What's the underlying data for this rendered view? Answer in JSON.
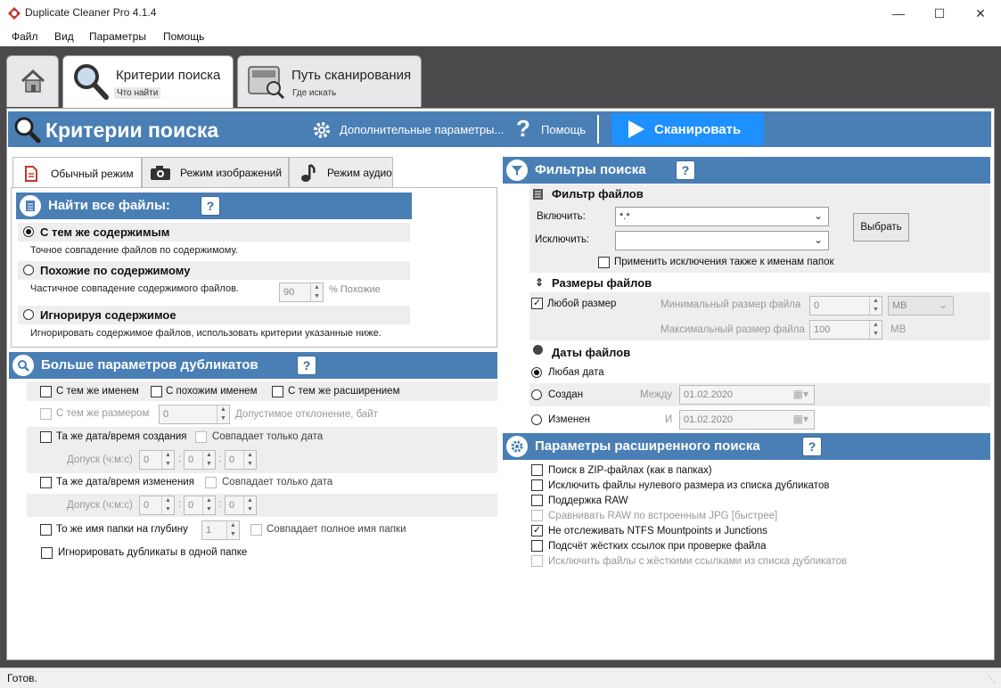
{
  "window": {
    "title": "Duplicate Cleaner Pro 4.1.4"
  },
  "menu": [
    "Файл",
    "Вид",
    "Параметры",
    "Помощь"
  ],
  "top_tabs": {
    "criteria": {
      "title": "Критерии поиска",
      "sub": "Что найти"
    },
    "scanpath": {
      "title": "Путь сканирования",
      "sub": "Где искать"
    }
  },
  "header": {
    "title": "Критерии поиска",
    "advanced": "Дополнительные параметры...",
    "help": "Помощь",
    "scan": "Сканировать"
  },
  "mode_tabs": [
    "Обычный режим",
    "Режим изображений",
    "Режим аудио"
  ],
  "find_all": {
    "title": "Найти все файлы:",
    "same": {
      "label": "С тем же содержимым",
      "desc": "Точное совпадение файлов по содержимому."
    },
    "similar": {
      "label": "Похожие по содержимому",
      "desc": "Частичное совпадение содержимого файлов.",
      "value": "90",
      "unit": "% Похожие"
    },
    "ignore": {
      "label": "Игнорируя содержимое",
      "desc": "Игнорировать содержимое файлов, использовать критерии указанные ниже."
    }
  },
  "more": {
    "title": "Больше параметров дубликатов",
    "same_name": "С тем же именем",
    "similar_name": "С похожим именем",
    "same_ext": "С тем же расширением",
    "same_size": "С тем же размером",
    "size_value": "0",
    "size_tol": "Допустимое отклонение, байт",
    "created": "Та же дата/время создания",
    "created_date_only": "Совпадает только дата",
    "tolerance": "Допуск (ч:м:с)",
    "t0": "0",
    "modified": "Та же дата/время изменения",
    "modified_date_only": "Совпадает только дата",
    "folder_depth": "То же имя папки на глубину",
    "depth_value": "1",
    "full_folder": "Совпадает полное имя папки",
    "ignore_same_folder": "Игнорировать дубликаты в одной папке"
  },
  "filters": {
    "title": "Фильтры поиска",
    "file_filter": "Фильтр файлов",
    "include_label": "Включить:",
    "include_value": "*.*",
    "exclude_label": "Исключить:",
    "exclude_value": "",
    "choose": "Выбрать",
    "apply_folders": "Применить исключения также к именам папок",
    "sizes": "Размеры файлов",
    "any_size": "Любой размер",
    "min_size": "Минимальный размер файла",
    "max_size": "Максимальный размер файла",
    "min_value": "0",
    "max_value": "100",
    "unit": "MB",
    "dates": "Даты файлов",
    "any_date": "Любая дата",
    "created": "Создан",
    "between": "Между",
    "modified": "Изменен",
    "and": "И",
    "date1": "01.02.2020",
    "date2": "01.02.2020"
  },
  "advanced": {
    "title": "Параметры расширенного поиска",
    "items": [
      {
        "label": "Поиск в ZIP-файлах (как в папках)",
        "checked": false,
        "disabled": false
      },
      {
        "label": "Исключить файлы нулевого размера из списка дубликатов",
        "checked": false,
        "disabled": false
      },
      {
        "label": "Поддержка RAW",
        "checked": false,
        "disabled": false
      },
      {
        "label": "Сравнивать RAW по встроенным JPG [быстрее]",
        "checked": false,
        "disabled": true
      },
      {
        "label": "Не отслеживать NTFS Mountpoints и Junctions",
        "checked": true,
        "disabled": false
      },
      {
        "label": "Подсчёт жёстких ссылок при проверке файла",
        "checked": false,
        "disabled": false
      },
      {
        "label": "Исключить файлы с жёсткими ссылками из списка дубликатов",
        "checked": false,
        "disabled": true
      }
    ]
  },
  "status": "Готов.",
  "colors": {
    "accent": "#4a7fb5",
    "scan": "#1e90ff"
  }
}
